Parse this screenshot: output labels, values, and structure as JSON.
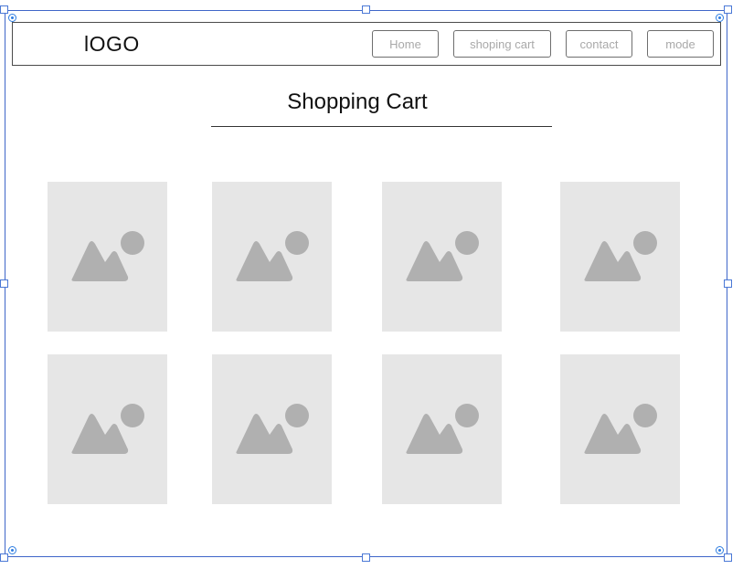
{
  "header": {
    "logo": "lOGO",
    "nav": [
      {
        "label": "Home"
      },
      {
        "label": "shoping cart"
      },
      {
        "label": "contact"
      },
      {
        "label": "mode"
      }
    ]
  },
  "main": {
    "title": "Shopping Cart",
    "product_images": [
      {
        "icon": "image-placeholder-icon"
      },
      {
        "icon": "image-placeholder-icon"
      },
      {
        "icon": "image-placeholder-icon"
      },
      {
        "icon": "image-placeholder-icon"
      },
      {
        "icon": "image-placeholder-icon"
      },
      {
        "icon": "image-placeholder-icon"
      },
      {
        "icon": "image-placeholder-icon"
      },
      {
        "icon": "image-placeholder-icon"
      }
    ]
  },
  "colors": {
    "placeholder_bg": "#e6e6e6",
    "placeholder_glyph": "#b0b0b0",
    "selection": "#3f66c9"
  }
}
